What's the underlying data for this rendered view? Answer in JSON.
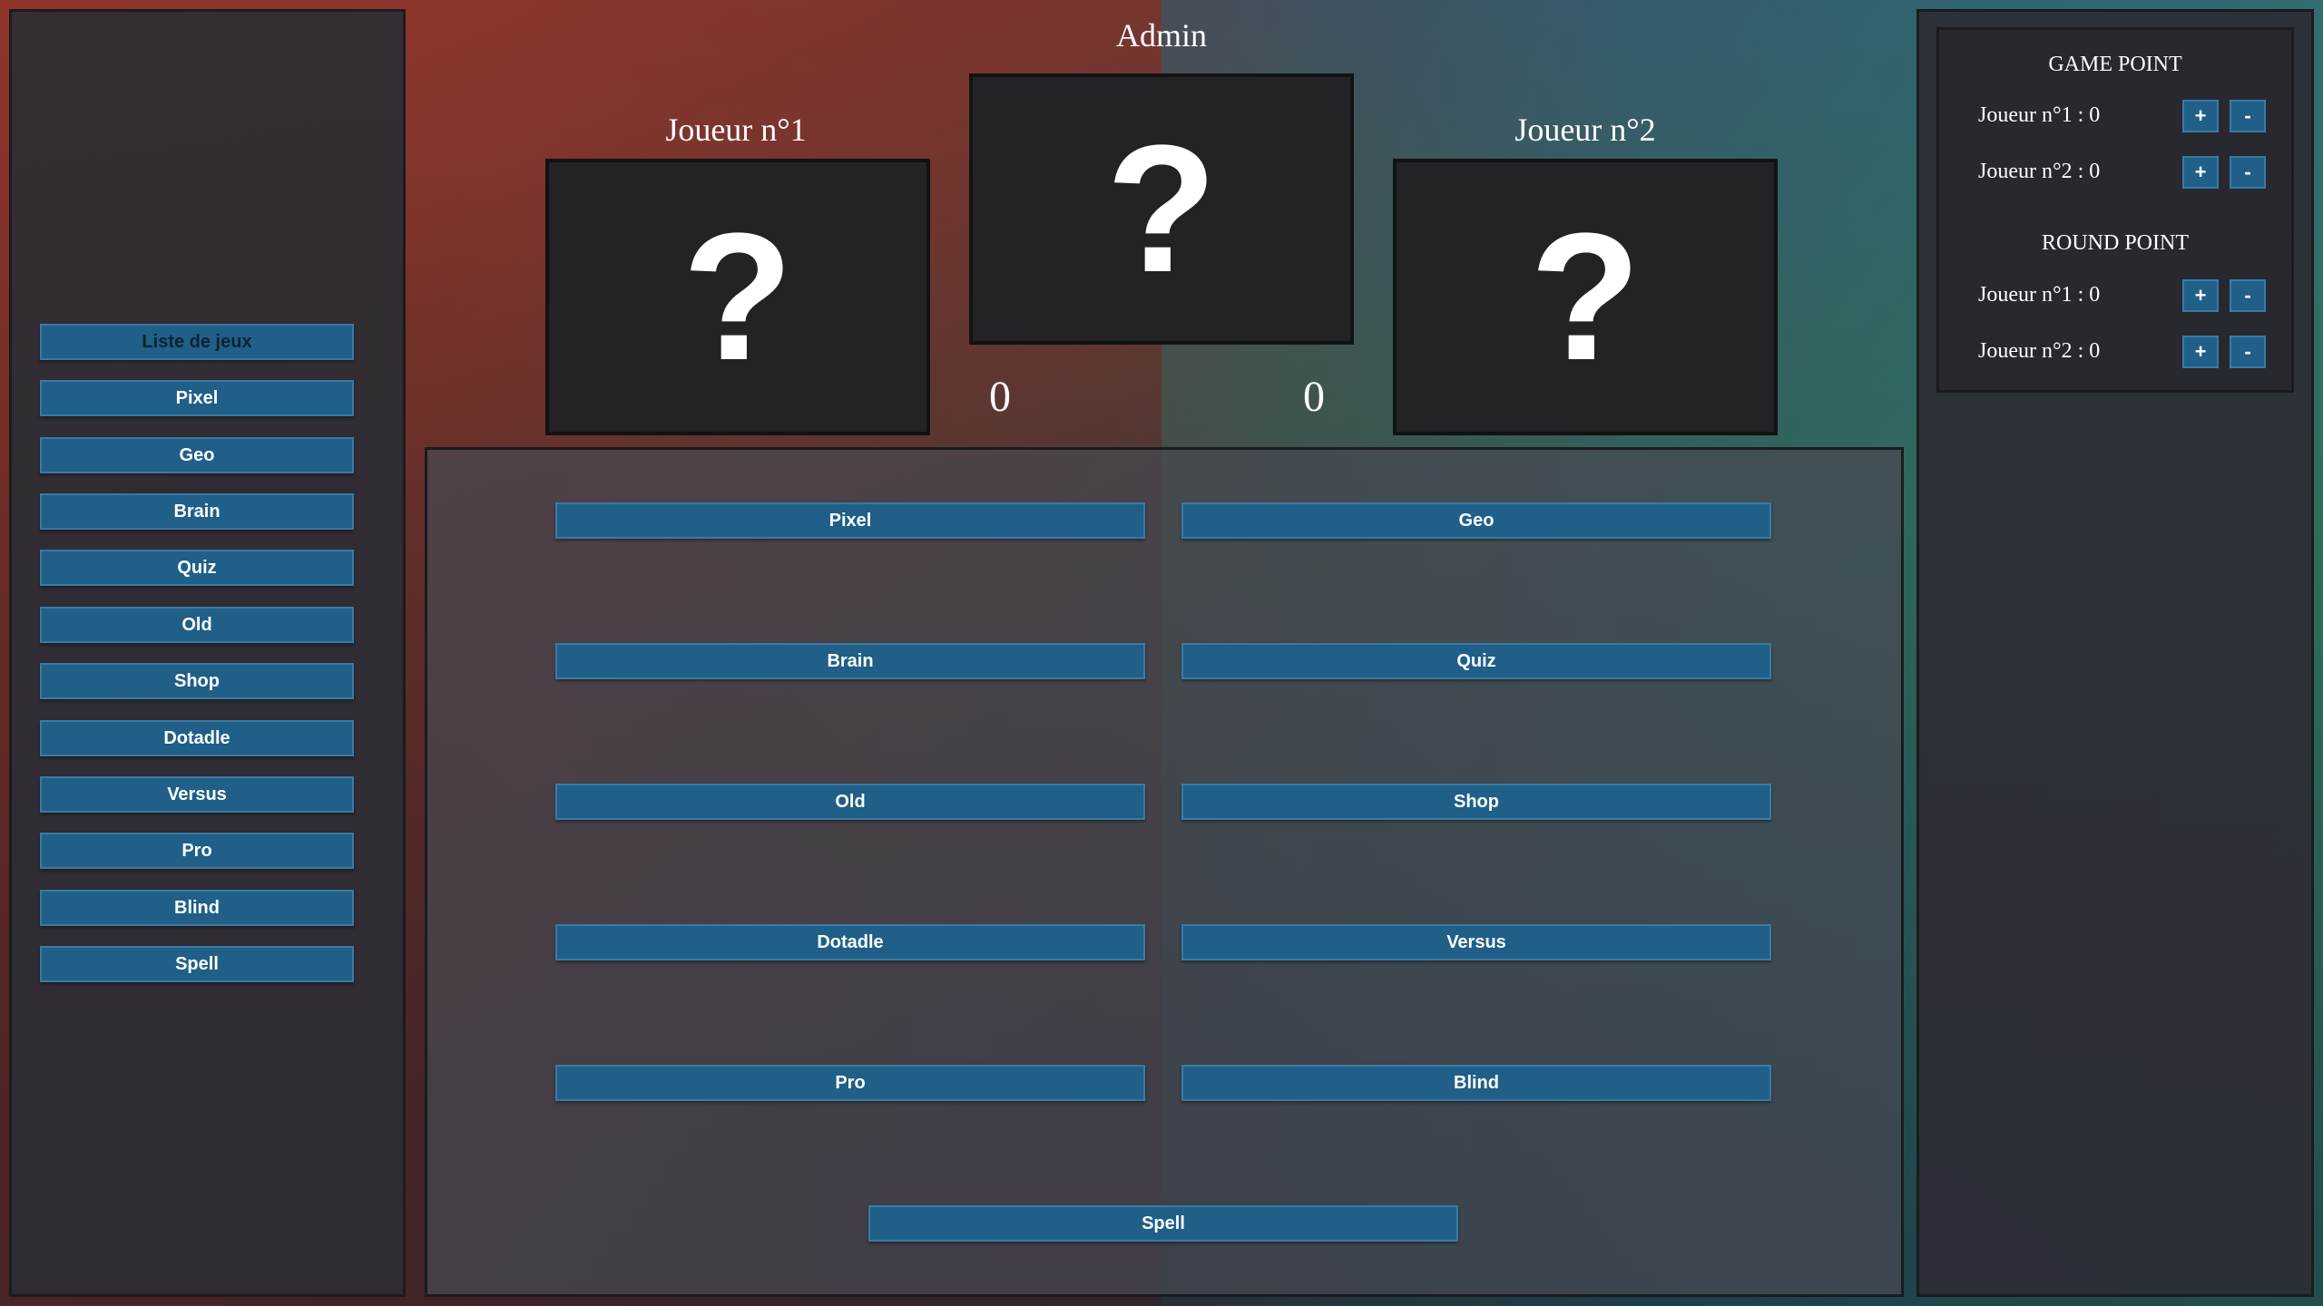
{
  "admin_title": "Admin",
  "sidebar": {
    "header": "Liste de jeux",
    "items": [
      "Pixel",
      "Geo",
      "Brain",
      "Quiz",
      "Old",
      "Shop",
      "Dotadle",
      "Versus",
      "Pro",
      "Blind",
      "Spell"
    ]
  },
  "players": {
    "p1": {
      "label": "Joueur n°1",
      "score": "0",
      "card": "?"
    },
    "center_card": "?",
    "p2": {
      "label": "Joueur n°2",
      "score": "0",
      "card": "?"
    }
  },
  "main_grid": {
    "buttons": [
      "Pixel",
      "Geo",
      "Brain",
      "Quiz",
      "Old",
      "Shop",
      "Dotadle",
      "Versus",
      "Pro",
      "Blind",
      "Spell"
    ]
  },
  "right_panel": {
    "game_point": {
      "heading": "GAME POINT",
      "rows": [
        {
          "label": "Joueur n°1 : 0",
          "plus": "+",
          "minus": "-"
        },
        {
          "label": "Joueur n°2 : 0",
          "plus": "+",
          "minus": "-"
        }
      ]
    },
    "round_point": {
      "heading": "ROUND POINT",
      "rows": [
        {
          "label": "Joueur n°1 : 0",
          "plus": "+",
          "minus": "-"
        },
        {
          "label": "Joueur n°2 : 0",
          "plus": "+",
          "minus": "-"
        }
      ]
    }
  },
  "colors": {
    "button_bg": "#1f5f88",
    "button_border": "#3b7aa4",
    "card_bg": "#232325"
  }
}
